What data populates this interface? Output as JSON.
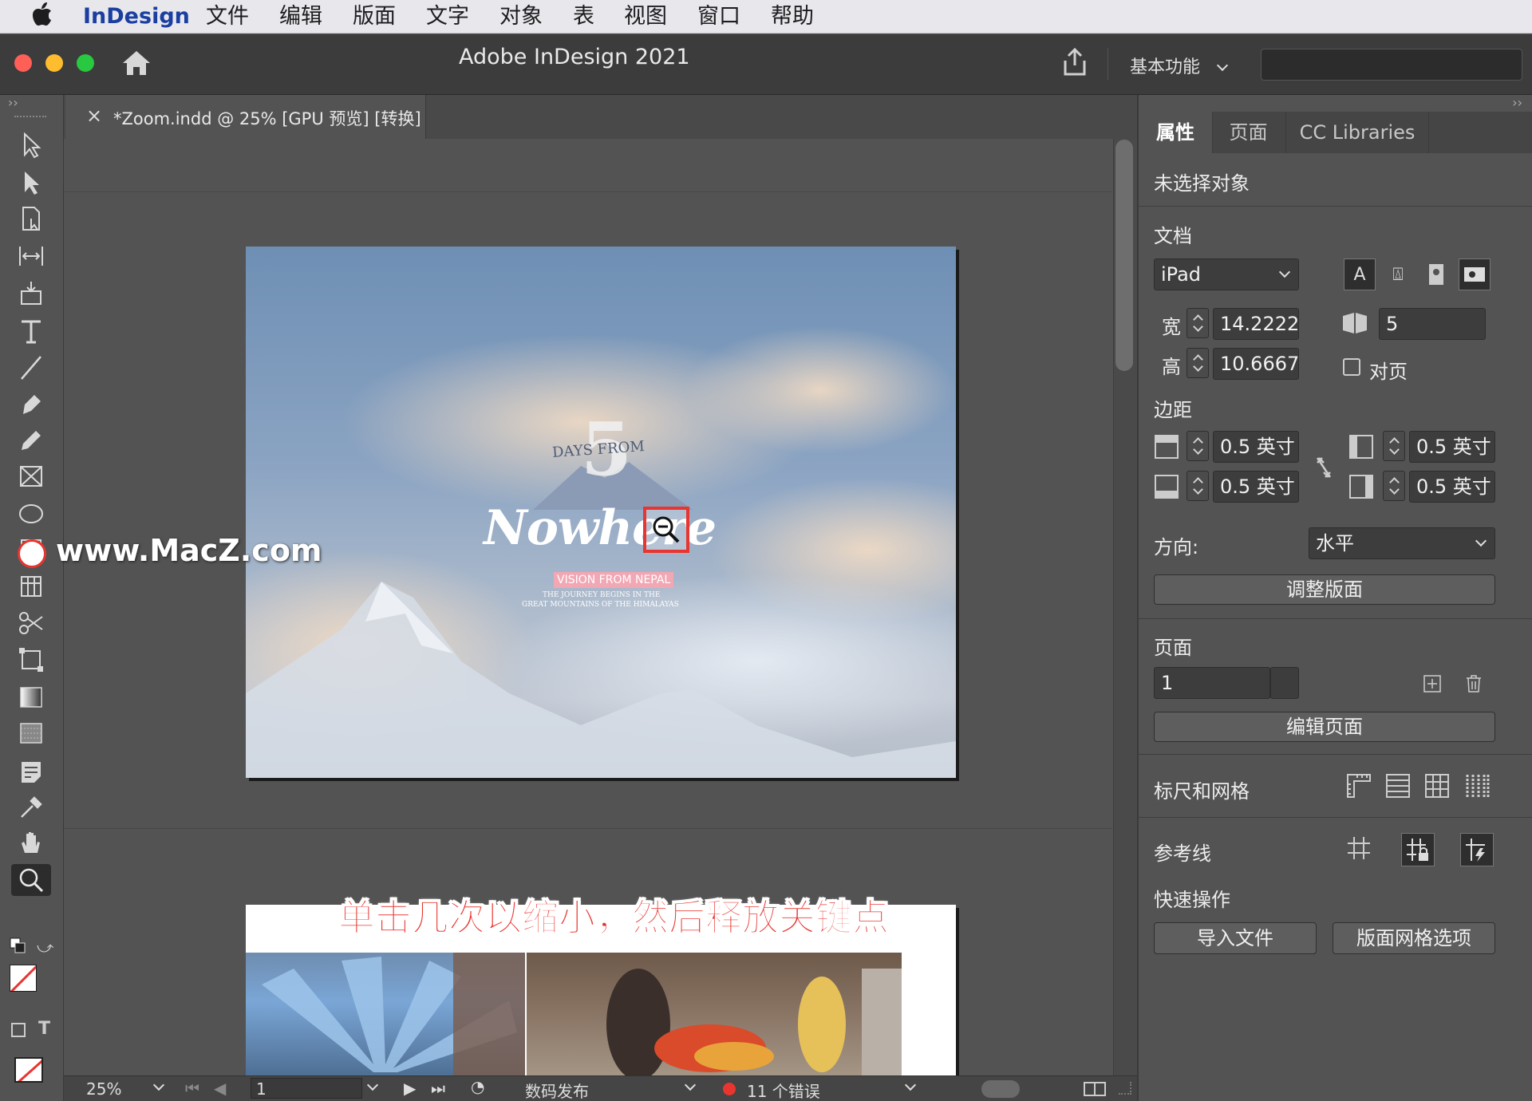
{
  "menubar": {
    "app_name": "InDesign",
    "items": [
      "文件",
      "编辑",
      "版面",
      "文字",
      "对象",
      "表",
      "视图",
      "窗口",
      "帮助"
    ]
  },
  "titlebar": {
    "title": "Adobe InDesign 2021",
    "workspace": "基本功能"
  },
  "document_tab": {
    "close_glyph": "×",
    "label": "*Zoom.indd @ 25% [GPU 预览] [转换]"
  },
  "page1": {
    "title_big": "5",
    "title_small": "DAYS FROM",
    "headline": "Nowhere",
    "tag": "VISION FROM NEPAL",
    "sub_line1": "THE JOURNEY BEGINS IN THE",
    "sub_line2": "GREAT MOUNTAINS OF THE HIMALAYAS"
  },
  "watermark": "www.MacZ.com",
  "caption": "单击几次以缩小，然后释放关键点",
  "status_bar": {
    "zoom": "25%",
    "page": "1",
    "profile": "数码发布",
    "errors": "11 个错误"
  },
  "panel": {
    "tabs": [
      "属性",
      "页面",
      "CC Libraries"
    ],
    "no_selection": "未选择对象",
    "document_heading": "文档",
    "preset": "iPad",
    "width_label": "宽",
    "width_value": "14.2222",
    "height_label": "高",
    "height_value": "10.6667",
    "pages_count": "5",
    "facing_label": "对页",
    "margins_heading": "边距",
    "margin_top": "0.5 英寸",
    "margin_bottom": "0.5 英寸",
    "margin_left": "0.5 英寸",
    "margin_right": "0.5 英寸",
    "orientation_label": "方向:",
    "orientation_value": "水平",
    "adjust_layout": "调整版面",
    "page_heading": "页面",
    "page_value": "1",
    "edit_page": "编辑页面",
    "rulers_grids": "标尺和网格",
    "guides": "参考线",
    "quick_actions": "快速操作",
    "import_file": "导入文件",
    "layout_grid_options": "版面网格选项"
  },
  "colors": {
    "accent_red": "#e8352f",
    "panel_bg": "#535353",
    "menubar_bg": "#e8e8ec",
    "app_name_color": "#1a3fa0"
  }
}
